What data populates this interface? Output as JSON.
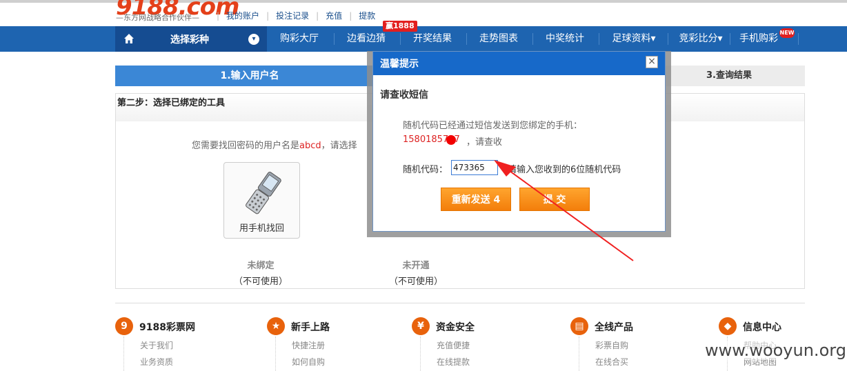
{
  "header": {
    "logo_text": "9188.com",
    "logo_sub": "—东方网战略合作伙伴—",
    "links": [
      "我的账户",
      "投注记录",
      "充值",
      "提款"
    ]
  },
  "nav": {
    "home_icon": "home-icon",
    "select_label": "选择彩种",
    "items": [
      "购彩大厅",
      "边看边猜",
      "开奖结果",
      "走势图表",
      "中奖统计",
      "足球资料▾",
      "竞彩比分▾",
      "手机购彩"
    ],
    "badge_win": "赢1888",
    "badge_new": "NEW"
  },
  "steps": {
    "step1": "1.输入用户名",
    "step3": "3.查询结果"
  },
  "panel": {
    "title": "第二步：选择已绑定的工具",
    "desc_prefix": "您需要找回密码的用户名是",
    "username": "abcd",
    "desc_suffix": "，请选择",
    "tool_label": "用手机找回",
    "status1": "未绑定",
    "status1_note": "（不可使用）",
    "status2": "未开通",
    "status2_note": "（不可使用）"
  },
  "dialog": {
    "title": "温馨提示",
    "close": "×",
    "subtitle": "请查收短信",
    "msg1": "随机代码已经通过短信发送到您绑定的手机：",
    "phone": "1580185727",
    "msg2": "，请查收",
    "code_label": "随机代码：",
    "code_value": "473365",
    "code_hint": "请输入您收到的6位随机代码",
    "resend_label": "重新发送 4",
    "submit_label": "提 交"
  },
  "footer": {
    "cols": [
      {
        "icon": "9",
        "title": "9188彩票网",
        "links": [
          "关于我们",
          "业务资质"
        ]
      },
      {
        "icon": "★",
        "title": "新手上路",
        "links": [
          "快捷注册",
          "如何自购"
        ]
      },
      {
        "icon": "¥",
        "title": "资金安全",
        "links": [
          "充值便捷",
          "在线提款"
        ]
      },
      {
        "icon": "▤",
        "title": "全线产品",
        "links": [
          "彩票自购",
          "在线合买"
        ]
      },
      {
        "icon": "◆",
        "title": "信息中心",
        "links": [
          "帮助中心",
          "网站地图"
        ]
      }
    ]
  },
  "watermark": "www.wooyun.org",
  "colors": {
    "nav_blue": "#1e64b0",
    "orange": "#f37e0b",
    "red": "#e21f1f"
  }
}
